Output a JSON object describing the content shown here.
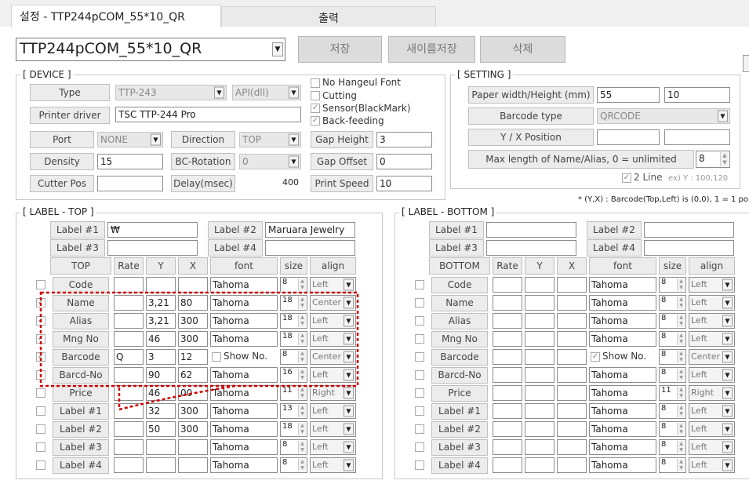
{
  "tabs": {
    "settings": "설정 - TTP244pCOM_55*10_QR",
    "output": "출력"
  },
  "profile": {
    "selected": "TTP244pCOM_55*10_QR"
  },
  "buttons": {
    "save": "저장",
    "save_as": "새이름저장",
    "delete": "삭제"
  },
  "device": {
    "title": "[ DEVICE ]",
    "type_label": "Type",
    "type_value": "TTP-243",
    "api_value": "API(dll)",
    "driver_label": "Printer driver",
    "driver_value": "TSC TTP-244 Pro",
    "port_label": "Port",
    "port_value": "NONE",
    "direction_label": "Direction",
    "direction_value": "TOP",
    "density_label": "Density",
    "density_value": "15",
    "bc_rotation_label": "BC-Rotation",
    "bc_rotation_value": "0",
    "cutter_label": "Cutter Pos",
    "cutter_value": "",
    "delay_label": "Delay(msec)",
    "delay_value": "400",
    "no_hangeul": "No Hangeul Font",
    "cutting": "Cutting",
    "sensor": "Sensor(BlackMark)",
    "back_feeding": "Back-feeding",
    "gap_height_label": "Gap Height",
    "gap_height_value": "3",
    "gap_offset_label": "Gap Offset",
    "gap_offset_value": "0",
    "print_speed_label": "Print Speed",
    "print_speed_value": "10"
  },
  "setting": {
    "title": "[ SETTING ]",
    "paper_label": "Paper width/Height (mm)",
    "paper_w": "55",
    "paper_h": "10",
    "barcode_type_label": "Barcode type",
    "barcode_type_value": "QRCODE",
    "yx_label": "Y / X Position",
    "y_value": "",
    "x_value": "",
    "maxlen_label": "Max length of Name/Alias, 0 = unlimited",
    "maxlen_value": "8",
    "two_line": "2 Line",
    "example": "ex) Y : 100,120",
    "note": "* (Y,X) : Barcode(Top,Left) is (0,0),  1 = 1 po"
  },
  "label_top": {
    "title": "[ LABEL - TOP ]",
    "label1": "Label #1",
    "label1_value": "₩",
    "label2": "Label #2",
    "label2_value": "Maruara Jewelry",
    "label3": "Label #3",
    "label3_value": "",
    "label4": "Label #4",
    "label4_value": "",
    "headers": [
      "TOP",
      "Rate",
      "Y",
      "X",
      "font",
      "size",
      "align"
    ],
    "rows": [
      {
        "name": "Code",
        "rate": "",
        "y": "",
        "x": "",
        "font": "Tahoma",
        "size": "8",
        "align": "Left",
        "checked": false
      },
      {
        "name": "Name",
        "rate": "",
        "y": "3,21",
        "x": "80",
        "font": "Tahoma",
        "size": "18",
        "align": "Center",
        "checked": true
      },
      {
        "name": "Alias",
        "rate": "",
        "y": "3,21",
        "x": "300",
        "font": "Tahoma",
        "size": "18",
        "align": "Left",
        "checked": true
      },
      {
        "name": "Mng No",
        "rate": "",
        "y": "46",
        "x": "300",
        "font": "Tahoma",
        "size": "18",
        "align": "Left",
        "checked": true
      },
      {
        "name": "Barcode",
        "rate": "Q",
        "y": "3",
        "x": "12",
        "font": "Show No.",
        "size": "8",
        "align": "Center",
        "checked": true
      },
      {
        "name": "Barcd-No",
        "rate": "",
        "y": "90",
        "x": "62",
        "font": "Tahoma",
        "size": "16",
        "align": "Left",
        "checked": false
      },
      {
        "name": "Price",
        "rate": "",
        "y": "46",
        "x": "00",
        "font": "Tahoma",
        "size": "11",
        "align": "Right",
        "checked": false
      },
      {
        "name": "Label #1",
        "rate": "",
        "y": "32",
        "x": "300",
        "font": "Tahoma",
        "size": "13",
        "align": "Left",
        "checked": false
      },
      {
        "name": "Label #2",
        "rate": "",
        "y": "50",
        "x": "300",
        "font": "Tahoma",
        "size": "18",
        "align": "Left",
        "checked": false
      },
      {
        "name": "Label #3",
        "rate": "",
        "y": "",
        "x": "",
        "font": "Tahoma",
        "size": "8",
        "align": "Left",
        "checked": false
      },
      {
        "name": "Label #4",
        "rate": "",
        "y": "",
        "x": "",
        "font": "Tahoma",
        "size": "8",
        "align": "Left",
        "checked": false
      }
    ]
  },
  "label_bottom": {
    "title": "[ LABEL - BOTTOM ]",
    "label1": "Label #1",
    "label1_value": "",
    "label2": "Label #2",
    "label2_value": "",
    "label3": "Label #3",
    "label3_value": "",
    "label4": "Label #4",
    "label4_value": "",
    "headers": [
      "BOTTOM",
      "Rate",
      "Y",
      "X",
      "font",
      "size",
      "align"
    ],
    "rows": [
      {
        "name": "Code",
        "font": "Tahoma",
        "size": "8",
        "align": "Left"
      },
      {
        "name": "Name",
        "font": "Tahoma",
        "size": "8",
        "align": "Left"
      },
      {
        "name": "Alias",
        "font": "Tahoma",
        "size": "8",
        "align": "Left"
      },
      {
        "name": "Mng No",
        "font": "Tahoma",
        "size": "8",
        "align": "Left"
      },
      {
        "name": "Barcode",
        "font": "Show No.",
        "size": "8",
        "align": "Center"
      },
      {
        "name": "Barcd-No",
        "font": "Tahoma",
        "size": "8",
        "align": "Left"
      },
      {
        "name": "Price",
        "font": "Tahoma",
        "size": "11",
        "align": "Right"
      },
      {
        "name": "Label #1",
        "font": "Tahoma",
        "size": "8",
        "align": "Left"
      },
      {
        "name": "Label #2",
        "font": "Tahoma",
        "size": "8",
        "align": "Left"
      },
      {
        "name": "Label #3",
        "font": "Tahoma",
        "size": "8",
        "align": "Left"
      },
      {
        "name": "Label #4",
        "font": "Tahoma",
        "size": "8",
        "align": "Left"
      }
    ]
  },
  "colors": {
    "highlight": "#cc0000"
  }
}
